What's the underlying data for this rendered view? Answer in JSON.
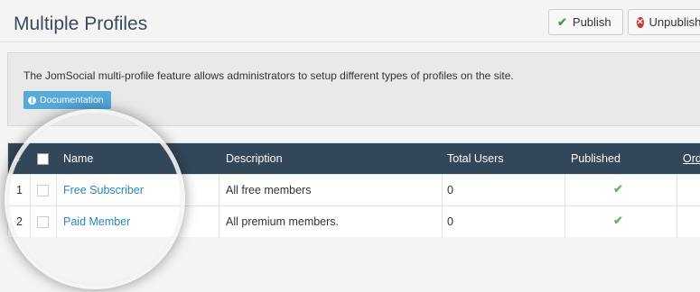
{
  "header": {
    "title": "Multiple Profiles",
    "publish_label": "Publish",
    "unpublish_label": "Unpublish"
  },
  "info": {
    "text": "The JomSocial multi-profile feature allows administrators to setup different types of profiles on the site.",
    "doc_label": "Documentation"
  },
  "table": {
    "columns": {
      "hash": "#",
      "name": "Name",
      "description": "Description",
      "total_users": "Total Users",
      "published": "Published",
      "ordering": "Ordering"
    },
    "rows": [
      {
        "num": "1",
        "name": "Free Subscriber",
        "description": "All free members",
        "total_users": "0",
        "published": "✔"
      },
      {
        "num": "2",
        "name": "Paid Member",
        "description": "All premium members.",
        "total_users": "0",
        "published": "✔"
      }
    ]
  },
  "icons": {
    "publish": "check-icon",
    "unpublish": "x-circle-icon",
    "documentation": "info-circle-icon"
  },
  "colors": {
    "header_bg": "#33475b",
    "link": "#2a86c2",
    "doc_button": "#55a9db",
    "check_green": "#6bb36b"
  }
}
